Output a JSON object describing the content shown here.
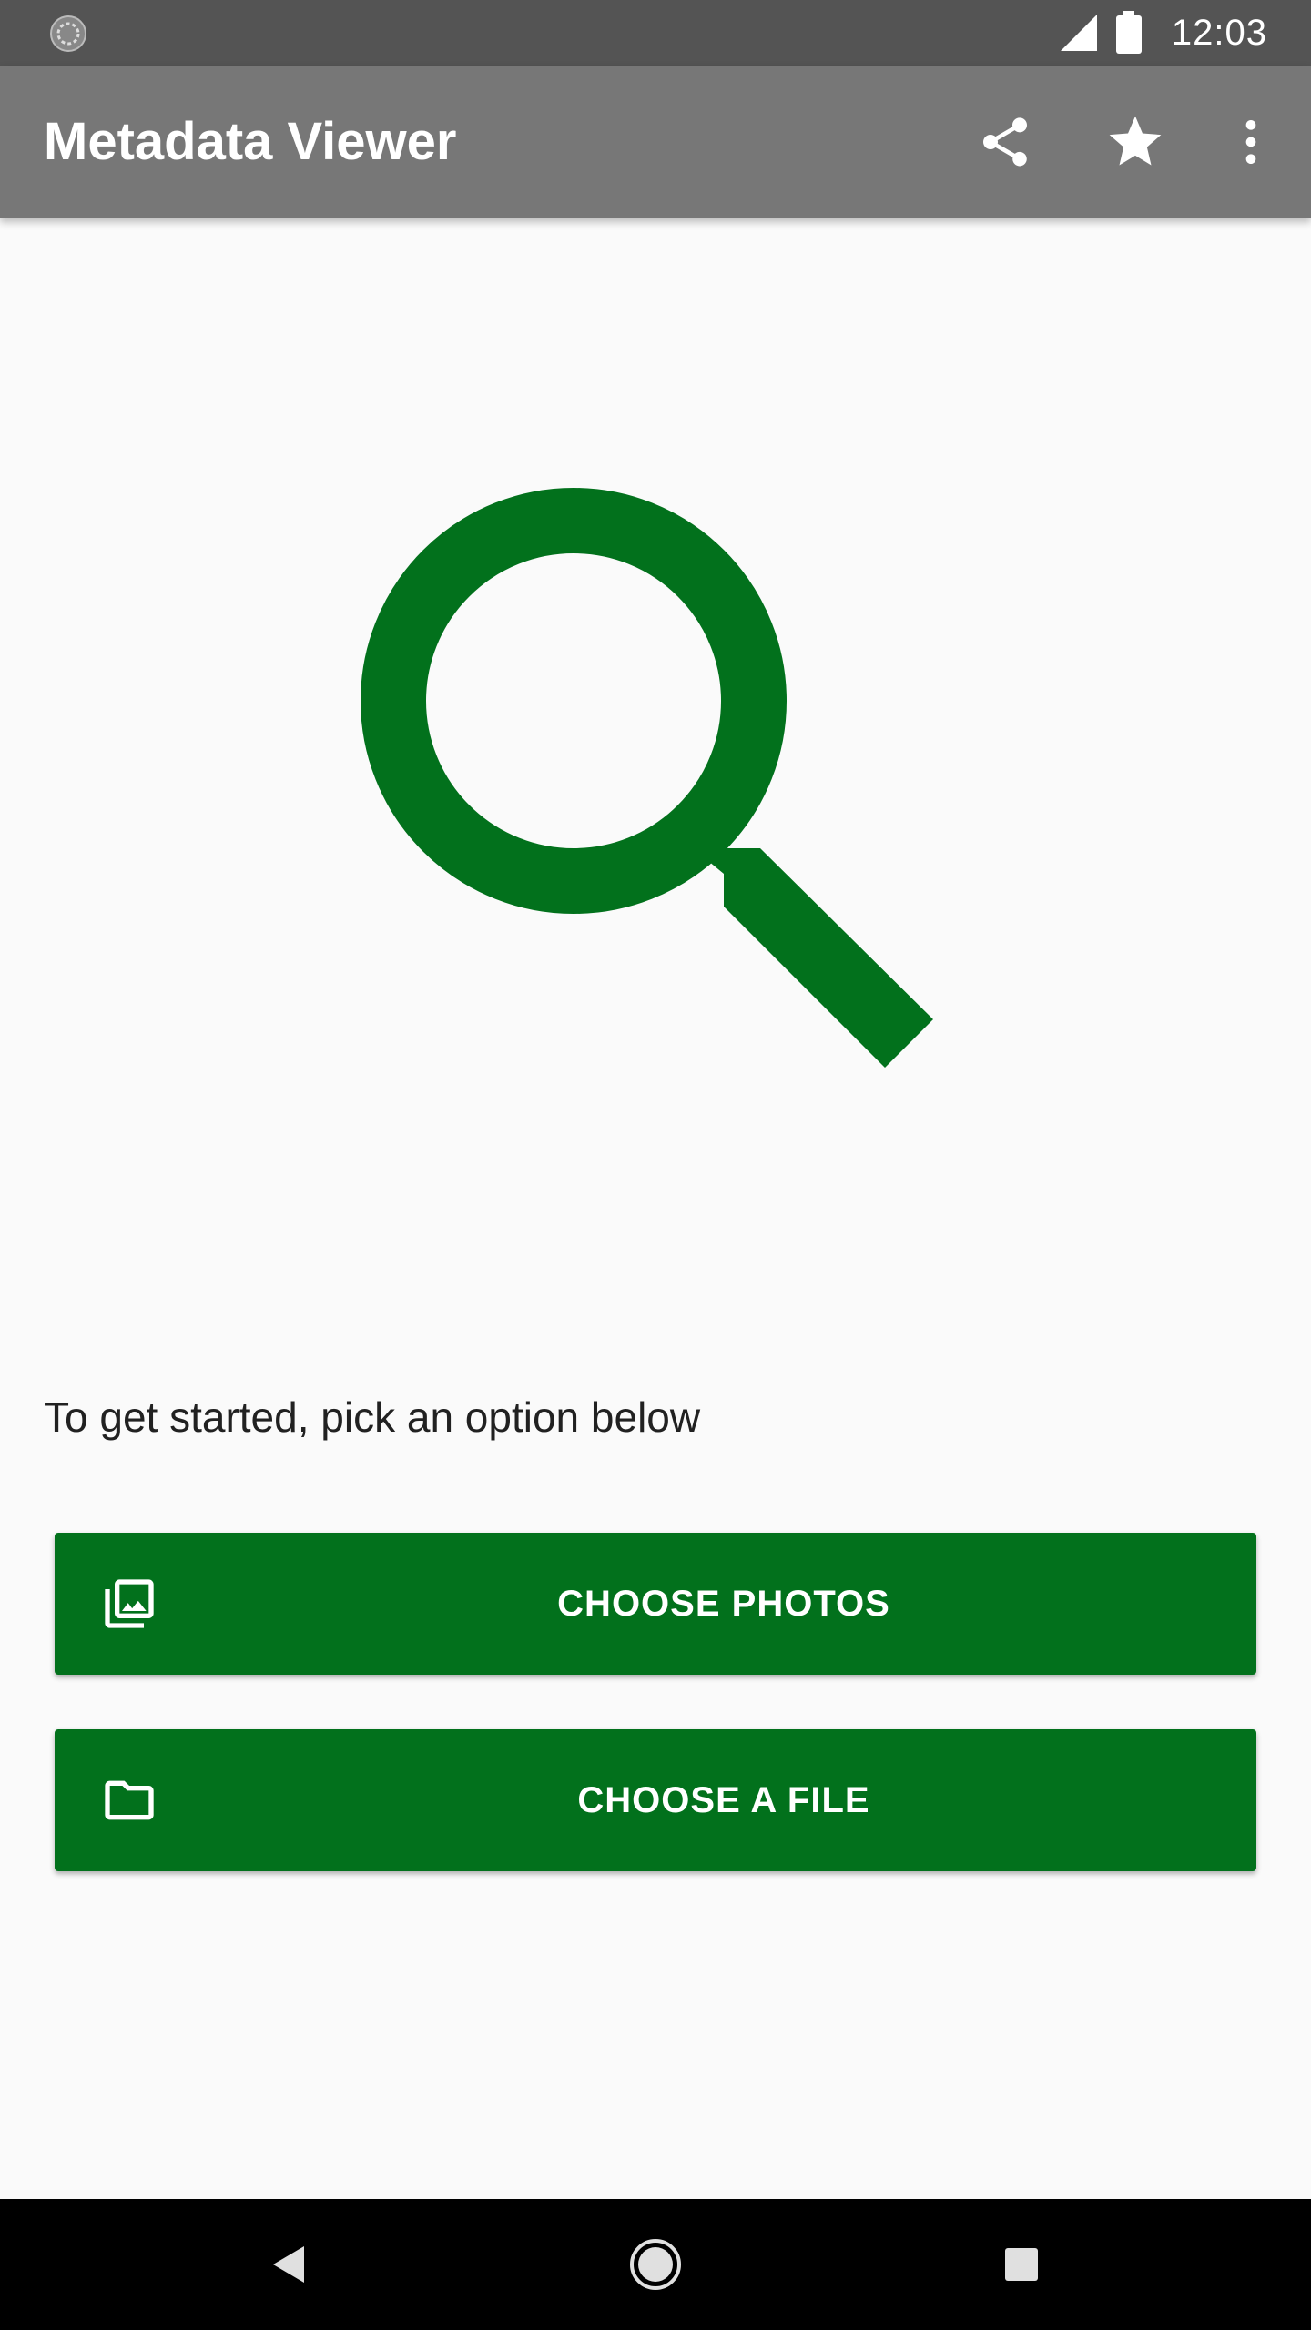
{
  "status_bar": {
    "time": "12:03",
    "icons": [
      "sync-icon",
      "signal-icon",
      "battery-icon"
    ]
  },
  "app_bar": {
    "title": "Metadata Viewer",
    "actions": [
      "share-icon",
      "star-icon",
      "more-vert-icon"
    ]
  },
  "main": {
    "hero_icon": "search-icon",
    "prompt": "To get started, pick an option below",
    "buttons": [
      {
        "label": "CHOOSE PHOTOS",
        "icon": "photo-library-icon"
      },
      {
        "label": "CHOOSE A FILE",
        "icon": "folder-icon"
      }
    ]
  },
  "nav_bar": {
    "buttons": [
      "back-icon",
      "home-icon",
      "recents-icon"
    ]
  },
  "colors": {
    "accent": "#02711c",
    "app_bar": "#777777",
    "status_bar": "#545454",
    "background": "#fafafa"
  }
}
